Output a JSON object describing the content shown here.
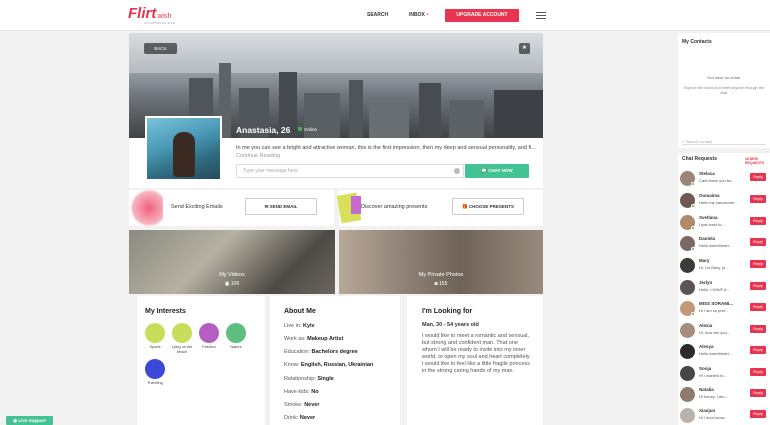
{
  "brand": {
    "name": "Flirt",
    "suffix": "wish",
    "tagline": "A FLIRTWISH SITE",
    "accent": "#e8344e",
    "green": "#43c393"
  },
  "nav": {
    "search": "SEARCH",
    "inbox": "INBOX",
    "inbox_dot": "•",
    "upgrade": "UPGRADE ACCOUNT"
  },
  "profile": {
    "back": "BACK",
    "name": "Anastasia, 26",
    "status": "Online",
    "bio": "In me you can see a bright and attractive woman, this is the first impression, then my deep and sensual personality, and fi...",
    "read_more": "Continue Reading",
    "message_placeholder": "Type your message here",
    "chat_button": "CHAT NOW"
  },
  "promos": [
    {
      "text": "Send Exciting Emails",
      "button": "SEND EMAIL"
    },
    {
      "text": "Discover amazing presents",
      "button": "CHOOSE PRESENTS"
    }
  ],
  "media": [
    {
      "label": "My Videos",
      "count": "106"
    },
    {
      "label": "My Private Photos",
      "count": "155"
    }
  ],
  "interests": {
    "title": "My Interests",
    "items": [
      {
        "label": "Sports",
        "color": "#c8de5a"
      },
      {
        "label": "Lying on the beach",
        "color": "#c8de5a"
      },
      {
        "label": "Fashion",
        "color": "#b45ec4"
      },
      {
        "label": "Nature",
        "color": "#5cbf7f"
      },
      {
        "label": "Traveling",
        "color": "#3c48d8"
      }
    ]
  },
  "about": {
    "title": "About Me",
    "rows": [
      {
        "k": "Live in:",
        "v": "Kyiv"
      },
      {
        "k": "Work as:",
        "v": "Makeup Artist"
      },
      {
        "k": "Education:",
        "v": "Bachelors degree"
      },
      {
        "k": "Know:",
        "v": "English, Russian, Ukrainian"
      },
      {
        "k": "Relationship:",
        "v": "Single"
      },
      {
        "k": "Have kids:",
        "v": "No"
      },
      {
        "k": "Smoke:",
        "v": "Never"
      },
      {
        "k": "Drink:",
        "v": "Never"
      }
    ]
  },
  "looking": {
    "title": "I'm Looking for",
    "age": "Man, 30 - 54 years old",
    "text": "I would like to meet a romantic and sensual, but strong and confident man. That one whom I will be ready to invite into my inner world, to open my soul and heart completely. I would like to feel like a little fragile princess in the strong caring hands of my man."
  },
  "contacts": {
    "title": "My Contacts",
    "empty": "You have no chats.",
    "hint": "Explore the world and meet anyone through the chat.",
    "search": "Search contact"
  },
  "requests": {
    "title": "Chat Requests",
    "badge": "16 NEW REQUESTS",
    "reply": "Reply",
    "items": [
      {
        "name": "Stelaca",
        "msg": "Cant leave you for..."
      },
      {
        "name": "Oumaima",
        "msg": "Hello my handsome..."
      },
      {
        "name": "Svetlana",
        "msg": "I just want to..."
      },
      {
        "name": "Daniela",
        "msg": "Hello sweetheart..."
      },
      {
        "name": "Mary",
        "msg": "Hi, I'm Mary, pl..."
      },
      {
        "name": "Jerlyn",
        "msg": "Hello, I HAVE A..."
      },
      {
        "name": "MISS SORAMI...",
        "msg": "Hi I am so pret..."
      },
      {
        "name": "Alexia",
        "msg": "Hi, how are you..."
      },
      {
        "name": "Alesya",
        "msg": "Hello sweetheart..."
      },
      {
        "name": "Sonja",
        "msg": "Hi I wanted to..."
      },
      {
        "name": "Natalia",
        "msg": "Hi honey, I am..."
      },
      {
        "name": "Xiaojun",
        "msg": "Hi I dont know..."
      }
    ]
  },
  "live_support": "Live Support"
}
